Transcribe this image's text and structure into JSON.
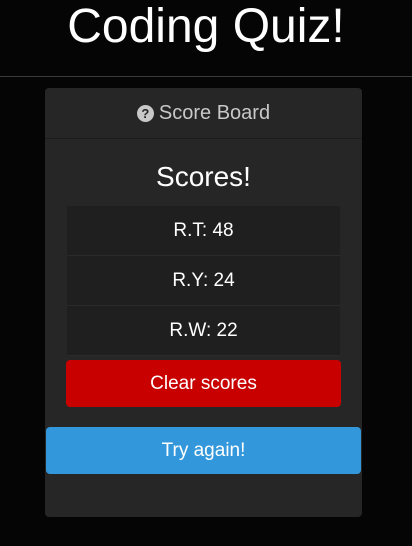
{
  "app": {
    "title": "Coding Quiz!"
  },
  "card": {
    "header_icon": "question-circle-icon",
    "header_label": "Score Board",
    "scores_title": "Scores!"
  },
  "scores": [
    {
      "label": "R.T: 48"
    },
    {
      "label": "R.Y: 24"
    },
    {
      "label": "R.W: 22"
    }
  ],
  "buttons": {
    "clear_label": "Clear scores",
    "try_again_label": "Try again!"
  },
  "colors": {
    "background": "#050505",
    "card": "#262626",
    "row": "#1f1f1f",
    "danger": "#c80000",
    "primary": "#3398db"
  }
}
